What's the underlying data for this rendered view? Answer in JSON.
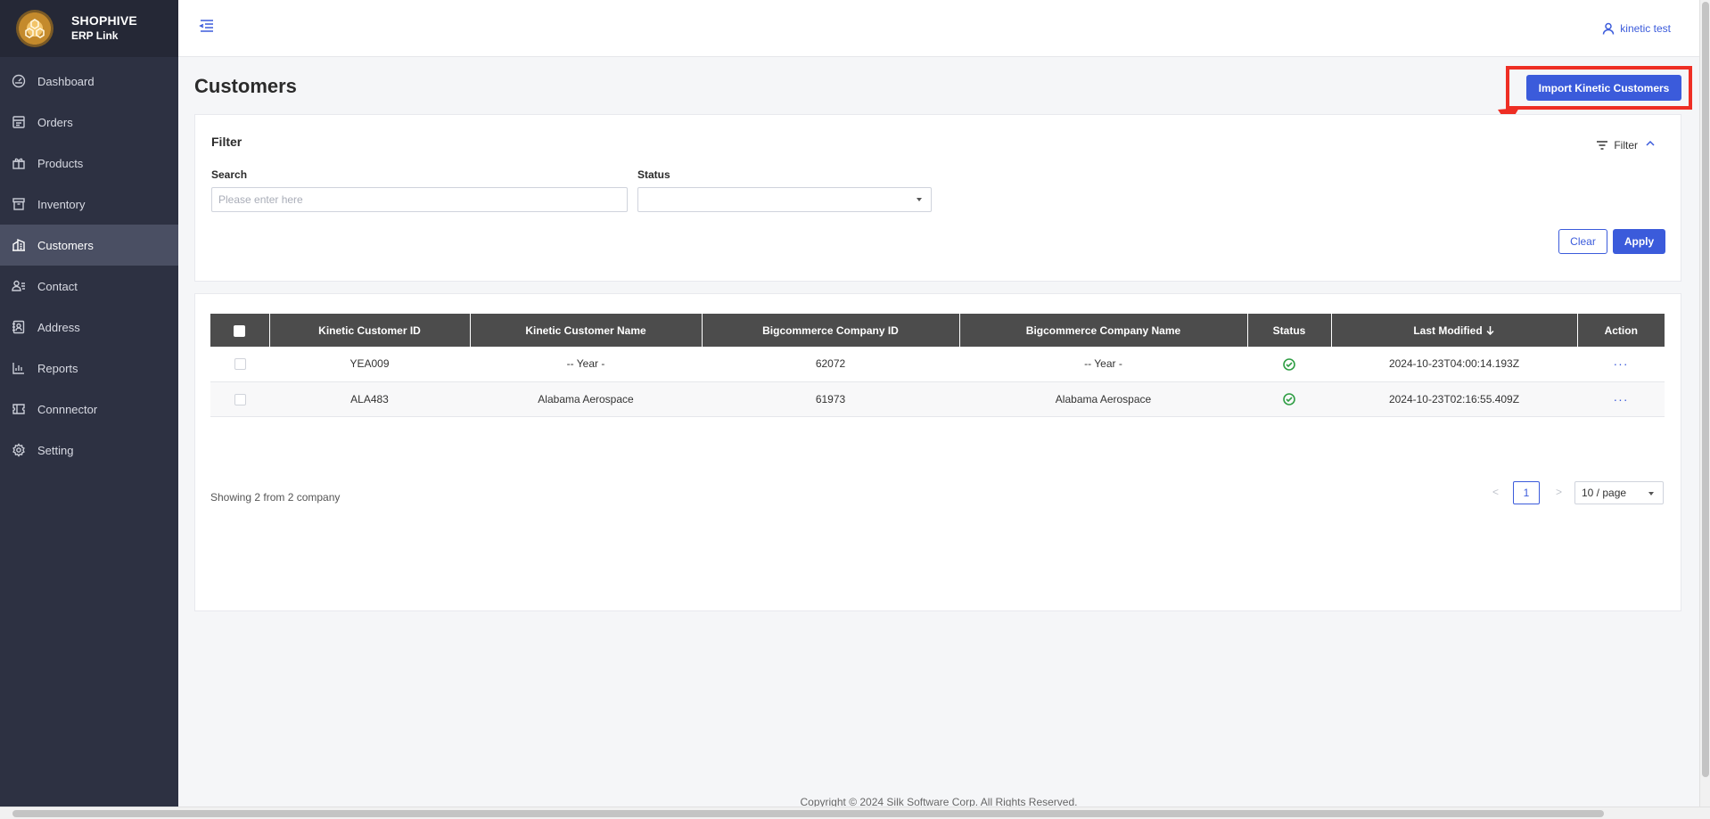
{
  "brand": {
    "title": "SHOPHIVE",
    "subtitle": "ERP Link"
  },
  "sidebar": {
    "items": [
      {
        "label": "Dashboard",
        "icon": "dashboard-icon"
      },
      {
        "label": "Orders",
        "icon": "orders-icon"
      },
      {
        "label": "Products",
        "icon": "products-icon"
      },
      {
        "label": "Inventory",
        "icon": "inventory-icon"
      },
      {
        "label": "Customers",
        "icon": "customers-icon",
        "active": true
      },
      {
        "label": "Contact",
        "icon": "contact-icon"
      },
      {
        "label": "Address",
        "icon": "address-icon"
      },
      {
        "label": "Reports",
        "icon": "reports-icon"
      },
      {
        "label": "Connnector",
        "icon": "connector-icon"
      },
      {
        "label": "Setting",
        "icon": "setting-icon"
      }
    ]
  },
  "header": {
    "user": "kinetic test"
  },
  "page": {
    "title": "Customers",
    "import_button": "Import Kinetic Customers"
  },
  "filter": {
    "title": "Filter",
    "toggle_label": "Filter",
    "search_label": "Search",
    "search_placeholder": "Please enter here",
    "search_value": "",
    "status_label": "Status",
    "status_value": "",
    "clear_label": "Clear",
    "apply_label": "Apply"
  },
  "table": {
    "headers": [
      "Kinetic Customer ID",
      "Kinetic Customer Name",
      "Bigcommerce Company ID",
      "Bigcommerce Company Name",
      "Status",
      "Last Modified",
      "Action"
    ],
    "rows": [
      {
        "kinetic_id": "YEA009",
        "kinetic_name": "-- Year -",
        "bc_id": "62072",
        "bc_name": "-- Year -",
        "status": "ok",
        "last_modified": "2024-10-23T04:00:14.193Z",
        "action": "···"
      },
      {
        "kinetic_id": "ALA483",
        "kinetic_name": "Alabama Aerospace",
        "bc_id": "61973",
        "bc_name": "Alabama Aerospace",
        "status": "ok",
        "last_modified": "2024-10-23T02:16:55.409Z",
        "action": "···"
      }
    ]
  },
  "pagination": {
    "showing": "Showing 2 from 2 company",
    "prev": "<",
    "current_page": "1",
    "next": ">",
    "page_size": "10 / page"
  },
  "footer": {
    "copyright": "Copyright © 2024 Silk Software Corp. All Rights Reserved."
  },
  "colors": {
    "accent": "#3b5bdb",
    "sidebar": "#2d3142",
    "highlight": "#ee2e24",
    "status_ok": "#2f9e44"
  }
}
